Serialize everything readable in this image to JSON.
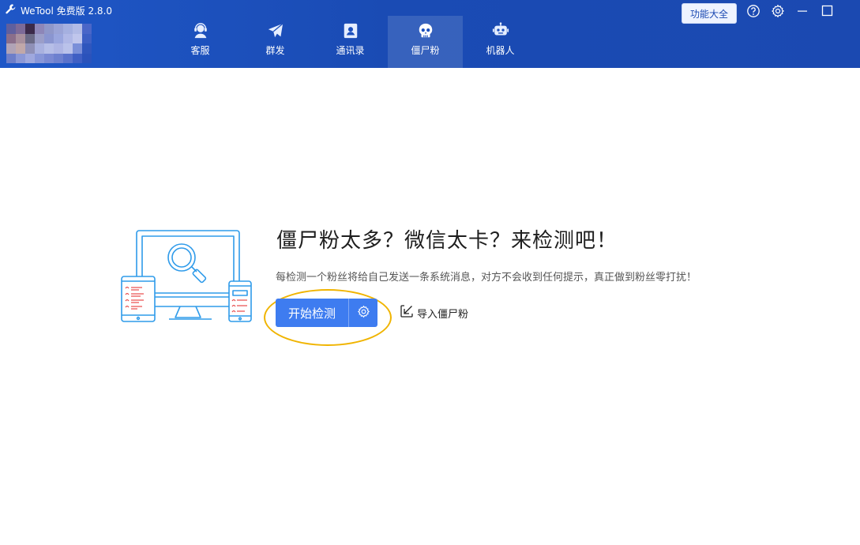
{
  "app": {
    "title": "WeTool 免费版 2.8.0"
  },
  "header": {
    "features_label": "功能大全",
    "tabs": [
      {
        "label": "客服",
        "icon": "customer-service-icon",
        "active": false
      },
      {
        "label": "群发",
        "icon": "paper-plane-icon",
        "active": false
      },
      {
        "label": "通讯录",
        "icon": "contacts-icon",
        "active": false
      },
      {
        "label": "僵尸粉",
        "icon": "skull-icon",
        "active": true
      },
      {
        "label": "机器人",
        "icon": "robot-icon",
        "active": false
      }
    ],
    "window_controls": [
      "help-icon",
      "settings-icon",
      "minimize-icon",
      "maximize-icon"
    ]
  },
  "main": {
    "headline": "僵尸粉太多？微信太卡？来检测吧！",
    "description": "每检测一个粉丝将给自己发送一条系统消息，对方不会收到任何提示，真正做到粉丝零打扰！",
    "start_label": "开始检测",
    "import_label": "导入僵尸粉"
  },
  "colors": {
    "header_bg": "#1b4fbd",
    "accent": "#3e7cf0",
    "highlight_ring": "#f0b400",
    "illustration_line": "#2f9bea",
    "illustration_mark": "#e84a4a"
  }
}
